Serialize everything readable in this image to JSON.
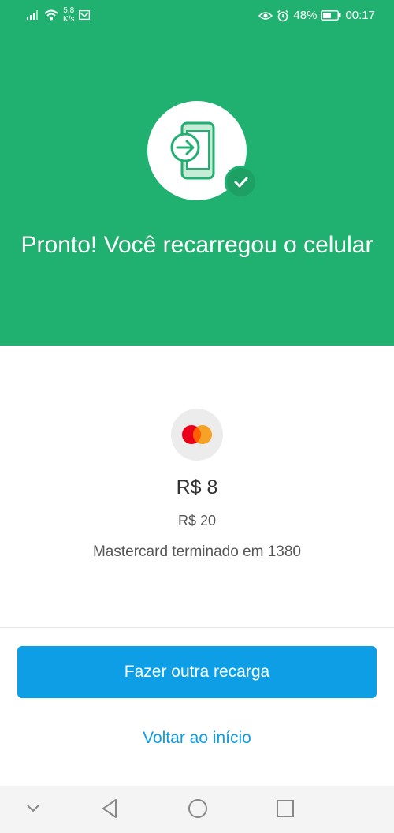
{
  "status_bar": {
    "speed_value": "5,8",
    "speed_unit": "K/s",
    "battery": "48%",
    "time": "00:17"
  },
  "hero": {
    "icon": "phone-recharge-icon",
    "badge_icon": "check-icon",
    "title": "Pronto! Você recarregou o celular"
  },
  "payment": {
    "card_icon": "mastercard-logo-icon",
    "amount": "R$ 8",
    "original_amount": "R$ 20",
    "card_description": "Mastercard terminado em 1380"
  },
  "actions": {
    "primary_label": "Fazer outra recarga",
    "secondary_label": "Voltar ao início"
  },
  "nav_bar": {
    "icons": [
      "chevron-down-icon",
      "back-icon",
      "home-icon",
      "recents-icon"
    ]
  },
  "colors": {
    "hero_green": "#20b06f",
    "badge_green": "#1e9f64",
    "primary_blue": "#0d9ee6"
  }
}
